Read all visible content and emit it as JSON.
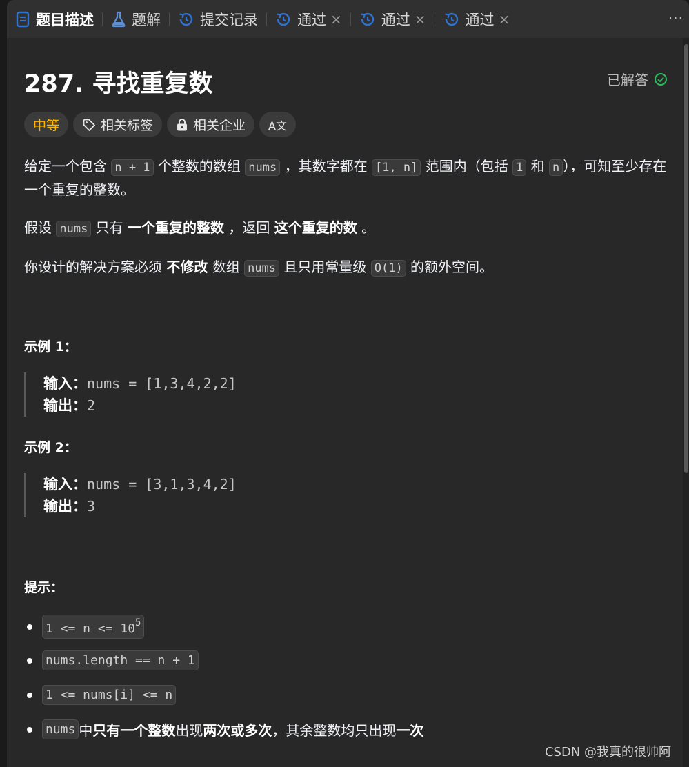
{
  "tabs": [
    {
      "label": "题目描述",
      "closable": false,
      "icon": "document-icon"
    },
    {
      "label": "题解",
      "closable": false,
      "icon": "flask-icon"
    },
    {
      "label": "提交记录",
      "closable": false,
      "icon": "history-icon"
    },
    {
      "label": "通过",
      "closable": true,
      "icon": "history-icon"
    },
    {
      "label": "通过",
      "closable": true,
      "icon": "history-icon"
    },
    {
      "label": "通过",
      "closable": true,
      "icon": "history-icon"
    }
  ],
  "close_glyph": "×",
  "more_glyph": "···",
  "problem": {
    "title": "287. 寻找重复数",
    "status": "已解答",
    "difficulty": "中等",
    "tags_label": "相关标签",
    "companies_label": "相关企业",
    "translate_glyph": "A文"
  },
  "description": {
    "p1": {
      "t1": "给定一个包含 ",
      "c1": "n + 1",
      "t2": " 个整数的数组 ",
      "c2": "nums",
      "t3": " ，其数字都在 ",
      "c3": "[1, n]",
      "t4": " 范围内（包括 ",
      "c4": "1",
      "t5": " 和 ",
      "c5": "n",
      "t6": "），可知至少存在一个重复的整数。"
    },
    "p2": {
      "t1": "假设 ",
      "c1": "nums",
      "t2": " 只有 ",
      "b1": "一个重复的整数",
      "t3": " ，返回 ",
      "b2": "这个重复的数",
      "t4": " 。"
    },
    "p3": {
      "t1": "你设计的解决方案必须 ",
      "b1": "不修改",
      "t2": " 数组 ",
      "c1": "nums",
      "t3": " 且只用常量级 ",
      "c2": "O(1)",
      "t4": " 的额外空间。"
    }
  },
  "examples": [
    {
      "heading": "示例 1：",
      "input_key": "输入：",
      "input_val": "nums = [1,3,4,2,2]",
      "output_key": "输出：",
      "output_val": "2"
    },
    {
      "heading": "示例 2：",
      "input_key": "输入：",
      "input_val": "nums = [3,1,3,4,2]",
      "output_key": "输出：",
      "output_val": "3"
    }
  ],
  "hints": {
    "heading": "提示：",
    "c1_base": "1 <= n <= 10",
    "c1_sup": "5",
    "c2": "nums.length == n + 1",
    "c3": "1 <= nums[i] <= n",
    "c4": {
      "code": "nums",
      "t1": " 中 ",
      "b1": "只有一个整数",
      "t2": " 出现 ",
      "b2": "两次或多次",
      "t3": " ，其余整数均只出现 ",
      "b3": "一次"
    }
  },
  "watermark": "CSDN @我真的很帅阿",
  "colors": {
    "difficulty": "#ffb800",
    "solved_check": "#2cbb5d",
    "tab_icon": "#2e72d2",
    "flask_icon": "#5e90d8"
  }
}
